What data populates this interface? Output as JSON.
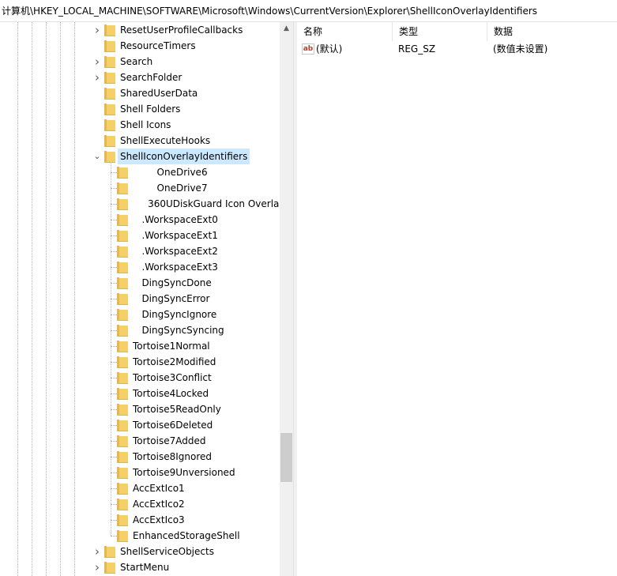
{
  "address_path": "计算机\\HKEY_LOCAL_MACHINE\\SOFTWARE\\Microsoft\\Windows\\CurrentVersion\\Explorer\\ShellIconOverlayIdentifiers",
  "tree": {
    "nodes": [
      {
        "label": "ResetUserProfileCallbacks",
        "expander": "collapsed"
      },
      {
        "label": "ResourceTimers",
        "expander": "none"
      },
      {
        "label": "Search",
        "expander": "collapsed"
      },
      {
        "label": "SearchFolder",
        "expander": "collapsed"
      },
      {
        "label": "SharedUserData",
        "expander": "none"
      },
      {
        "label": "Shell Folders",
        "expander": "none"
      },
      {
        "label": "Shell Icons",
        "expander": "none"
      },
      {
        "label": "ShellExecuteHooks",
        "expander": "none"
      },
      {
        "label": "ShellIconOverlayIdentifiers",
        "expander": "expanded",
        "selected": true
      },
      {
        "label": "        OneDrive6",
        "expander": "none",
        "child": true
      },
      {
        "label": "        OneDrive7",
        "expander": "none",
        "child": true
      },
      {
        "label": "     360UDiskGuard Icon Overla",
        "expander": "none",
        "child": true
      },
      {
        "label": "   .WorkspaceExt0",
        "expander": "none",
        "child": true
      },
      {
        "label": "   .WorkspaceExt1",
        "expander": "none",
        "child": true
      },
      {
        "label": "   .WorkspaceExt2",
        "expander": "none",
        "child": true
      },
      {
        "label": "   .WorkspaceExt3",
        "expander": "none",
        "child": true
      },
      {
        "label": "   DingSyncDone",
        "expander": "none",
        "child": true
      },
      {
        "label": "   DingSyncError",
        "expander": "none",
        "child": true
      },
      {
        "label": "   DingSyncIgnore",
        "expander": "none",
        "child": true
      },
      {
        "label": "   DingSyncSyncing",
        "expander": "none",
        "child": true
      },
      {
        "label": "Tortoise1Normal",
        "expander": "none",
        "child": true
      },
      {
        "label": "Tortoise2Modified",
        "expander": "none",
        "child": true
      },
      {
        "label": "Tortoise3Conflict",
        "expander": "none",
        "child": true
      },
      {
        "label": "Tortoise4Locked",
        "expander": "none",
        "child": true
      },
      {
        "label": "Tortoise5ReadOnly",
        "expander": "none",
        "child": true
      },
      {
        "label": "Tortoise6Deleted",
        "expander": "none",
        "child": true
      },
      {
        "label": "Tortoise7Added",
        "expander": "none",
        "child": true
      },
      {
        "label": "Tortoise8Ignored",
        "expander": "none",
        "child": true
      },
      {
        "label": "Tortoise9Unversioned",
        "expander": "none",
        "child": true
      },
      {
        "label": "AccExtIco1",
        "expander": "none",
        "child": true
      },
      {
        "label": "AccExtIco2",
        "expander": "none",
        "child": true
      },
      {
        "label": "AccExtIco3",
        "expander": "none",
        "child": true
      },
      {
        "label": "EnhancedStorageShell",
        "expander": "none",
        "child": true
      },
      {
        "label": "ShellServiceObjects",
        "expander": "collapsed"
      },
      {
        "label": "StartMenu",
        "expander": "collapsed"
      }
    ]
  },
  "list": {
    "columns": {
      "name": "名称",
      "type": "类型",
      "data": "数据"
    },
    "rows": [
      {
        "icon": "string-value-icon",
        "name": "(默认)",
        "type": "REG_SZ",
        "data": "(数值未设置)"
      }
    ]
  },
  "colors": {
    "selection": "#cce8ff",
    "folder": "#f4cf6a"
  }
}
